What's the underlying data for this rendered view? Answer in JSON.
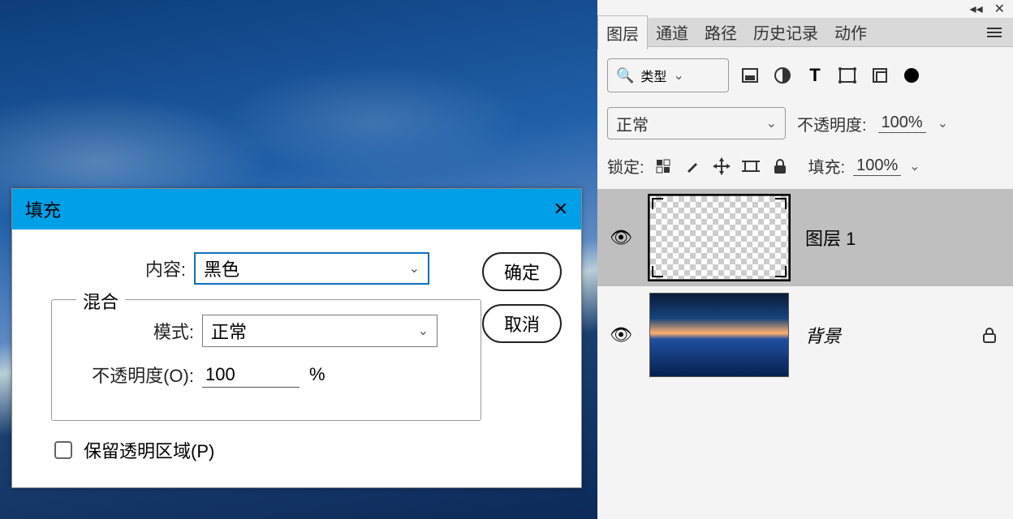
{
  "dialog": {
    "title": "填充",
    "content_label": "内容:",
    "content_value": "黑色",
    "blend_legend": "混合",
    "mode_label": "模式:",
    "mode_value": "正常",
    "opacity_label": "不透明度(O):",
    "opacity_value": "100",
    "opacity_unit": "%",
    "preserve_label": "保留透明区域(P)",
    "ok": "确定",
    "cancel": "取消"
  },
  "panels": {
    "tabs": [
      "图层",
      "通道",
      "路径",
      "历史记录",
      "动作"
    ],
    "type_filter": "类型",
    "blend_mode": "正常",
    "opacity_label": "不透明度:",
    "opacity_value": "100%",
    "lock_label": "锁定:",
    "fill_label": "填充:",
    "fill_value": "100%",
    "layers": [
      {
        "name": "图层 1",
        "locked": false,
        "visible": true,
        "selected": true,
        "thumb": "transparent"
      },
      {
        "name": "背景",
        "locked": true,
        "visible": true,
        "selected": false,
        "thumb": "image",
        "italic": true
      }
    ]
  }
}
